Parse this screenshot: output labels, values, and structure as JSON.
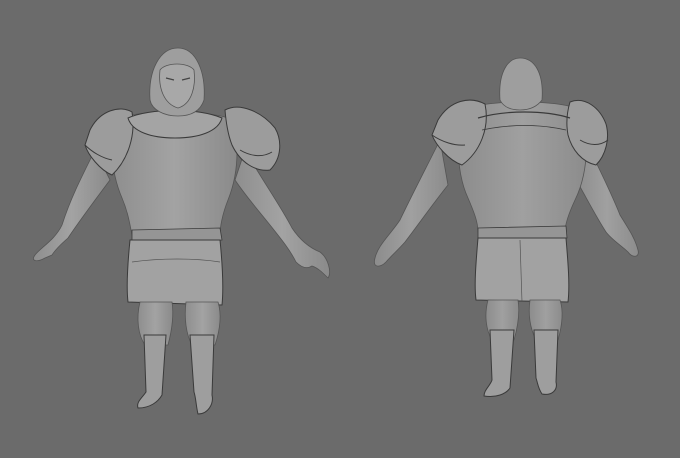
{
  "scene": {
    "background_color": "#6b6b6b",
    "model_fill": "#9a9a9a",
    "model_shade": "#8a8a8a",
    "model_highlight": "#a6a6a6",
    "edge_color": "#3a3a3a",
    "views": [
      {
        "id": "front",
        "icon": "character-front-view-icon"
      },
      {
        "id": "back",
        "icon": "character-back-view-icon"
      }
    ]
  }
}
